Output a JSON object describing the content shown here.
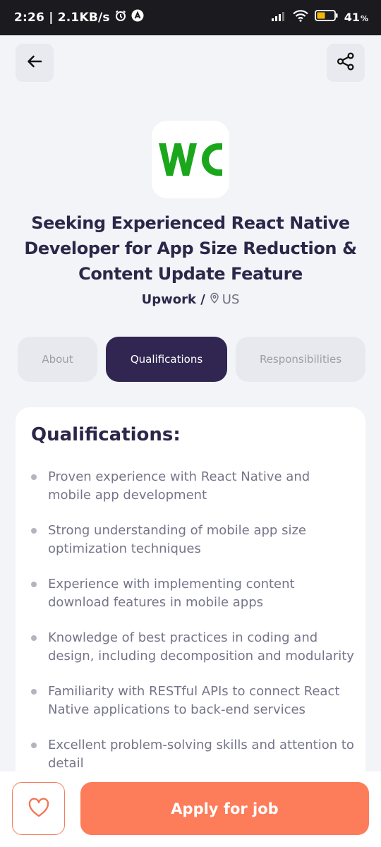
{
  "status_bar": {
    "time_speed": "2:26 | 2.1KB/s",
    "battery": "41",
    "battery_unit": "%",
    "icons": [
      "alarm-icon",
      "app-notification-icon",
      "signal-icon",
      "wifi-icon",
      "battery-icon"
    ]
  },
  "header": {
    "back_icon": "arrow-left-icon",
    "share_icon": "share-icon"
  },
  "job": {
    "logo_text": "WC",
    "title": "Seeking Experienced React Native Developer for App Size Reduction & Content Update Feature",
    "company": "Upwork /",
    "location": "US"
  },
  "tabs": [
    {
      "label": "About",
      "active": false
    },
    {
      "label": "Qualifications",
      "active": true
    },
    {
      "label": "Responsibilities",
      "active": false
    }
  ],
  "qualifications": {
    "heading": "Qualifications:",
    "items": [
      "Proven experience with React Native and mobile app development",
      "Strong understanding of mobile app size optimization techniques",
      "Experience with implementing content download features in mobile apps",
      "Knowledge of best practices in coding and design, including decomposition and modularity",
      "Familiarity with RESTful APIs to connect React Native applications to back-end services",
      "Excellent problem-solving skills and attention to detail"
    ]
  },
  "footer": {
    "like_icon": "heart-icon",
    "apply_label": "Apply for job"
  },
  "colors": {
    "primary_dark": "#302651",
    "accent": "#fd7c5a",
    "logo_green": "#1aa71b"
  }
}
